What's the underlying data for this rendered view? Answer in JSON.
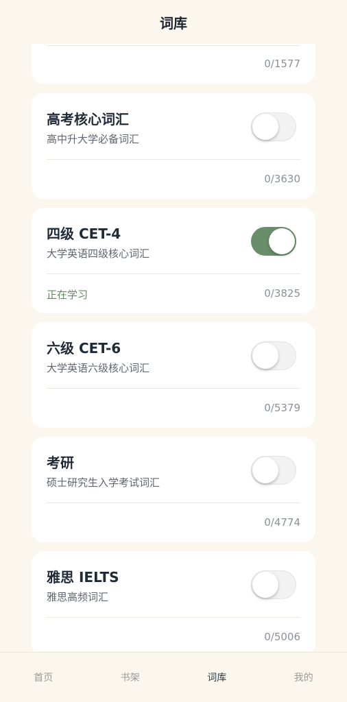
{
  "header": {
    "title": "词库"
  },
  "partial_card": {
    "count": "0/1577"
  },
  "cards": [
    {
      "title": "高考核心词汇",
      "subtitle": "高中升大学必备词汇",
      "status": "",
      "count": "0/3630",
      "enabled": false
    },
    {
      "title": "四级 CET-4",
      "subtitle": "大学英语四级核心词汇",
      "status": "正在学习",
      "count": "0/3825",
      "enabled": true
    },
    {
      "title": "六级 CET-6",
      "subtitle": "大学英语六级核心词汇",
      "status": "",
      "count": "0/5379",
      "enabled": false
    },
    {
      "title": "考研",
      "subtitle": "硕士研究生入学考试词汇",
      "status": "",
      "count": "0/4774",
      "enabled": false
    },
    {
      "title": "雅思 IELTS",
      "subtitle": "雅思高频词汇",
      "status": "",
      "count": "0/5006",
      "enabled": false
    }
  ],
  "tabbar": {
    "items": [
      {
        "label": "首页",
        "active": false
      },
      {
        "label": "书架",
        "active": false
      },
      {
        "label": "词库",
        "active": true
      },
      {
        "label": "我的",
        "active": false
      }
    ]
  },
  "colors": {
    "accent": "#6a8d6a",
    "background": "#fbf7ee"
  }
}
